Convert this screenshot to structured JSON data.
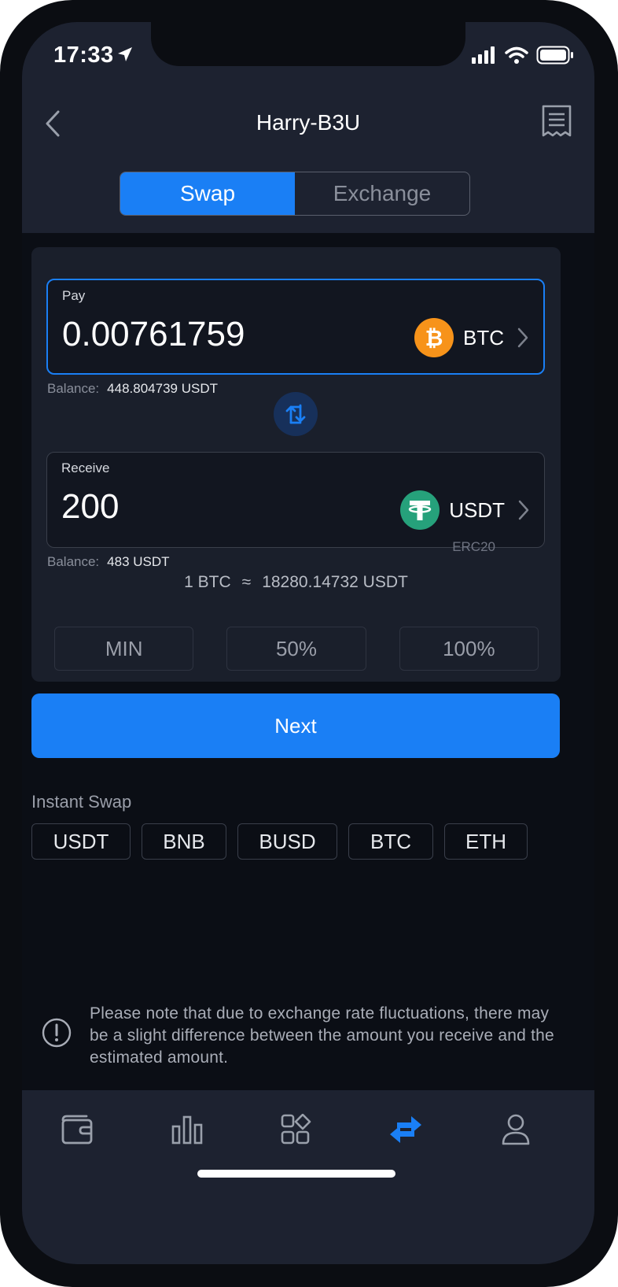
{
  "status_bar": {
    "time": "17:33"
  },
  "header": {
    "title": "Harry-B3U"
  },
  "segmented": {
    "swap_label": "Swap",
    "exchange_label": "Exchange"
  },
  "pay": {
    "label": "Pay",
    "amount": "0.00761759",
    "coin": "BTC",
    "coin_color": "#f7931a",
    "balance_label": "Balance:",
    "balance_value": "448.804739 USDT"
  },
  "receive": {
    "label": "Receive",
    "amount": "200",
    "coin": "USDT",
    "coin_network": "ERC20",
    "coin_color": "#26a17b",
    "balance_label": "Balance:",
    "balance_value": "483 USDT"
  },
  "rate": {
    "left": "1 BTC",
    "approx": "≈",
    "right": "18280.14732 USDT"
  },
  "percent_buttons": {
    "min": "MIN",
    "half": "50%",
    "full": "100%"
  },
  "next_button": "Next",
  "instant_swap": {
    "label": "Instant Swap",
    "chips": [
      "USDT",
      "BNB",
      "BUSD",
      "BTC",
      "ETH"
    ]
  },
  "notice": "Please note that due to exchange rate fluctuations, there may be a slight difference between the amount you receive and the estimated amount.",
  "colors": {
    "accent": "#1a7ff5",
    "background": "#0b0e15",
    "panel": "#1a1f2b"
  },
  "tabs": {
    "wallet": "wallet-icon",
    "markets": "bar-chart-icon",
    "apps": "apps-grid-icon",
    "swap": "swap-arrows-icon",
    "profile": "user-icon",
    "active": "swap"
  }
}
